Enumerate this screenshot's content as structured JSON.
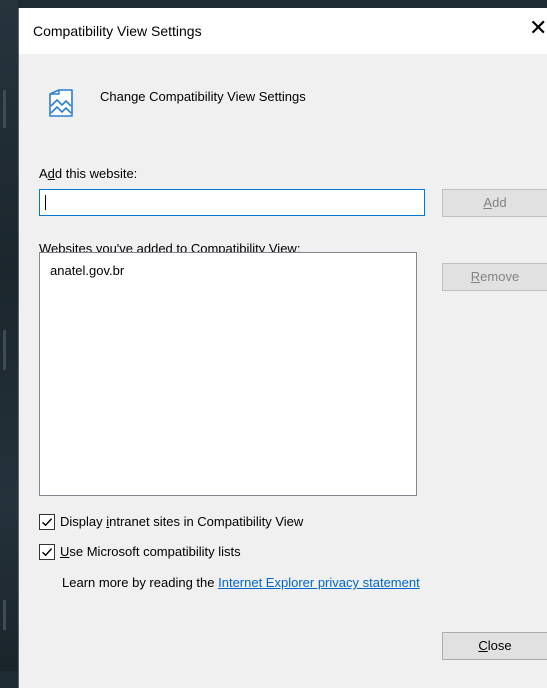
{
  "dialog": {
    "title": "Compatibility View Settings",
    "close_glyph": "✕",
    "header_icon": "compatibility-page-icon",
    "header_text": "Change Compatibility View Settings"
  },
  "add_section": {
    "label_prefix": "A",
    "label_mnemonic": "d",
    "label_suffix": "d this website:",
    "input_value": "",
    "add_button_mnemonic": "A",
    "add_button_rest": "dd"
  },
  "list_section": {
    "label_mnemonic": "W",
    "label_rest": "ebsites you've added to Compatibility View:",
    "items": [
      "anatel.gov.br"
    ],
    "remove_button_mnemonic": "R",
    "remove_button_rest": "emove"
  },
  "options": {
    "intranet": {
      "checked": true,
      "prefix": "Display ",
      "mnemonic": "i",
      "rest": "ntranet sites in Compatibility View"
    },
    "ms_lists": {
      "checked": true,
      "prefix": "",
      "mnemonic": "U",
      "rest": "se Microsoft compatibility lists"
    }
  },
  "learn_more": {
    "text": "Learn more by reading the ",
    "link_text": "Internet Explorer privacy statement"
  },
  "footer": {
    "close_mnemonic": "C",
    "close_rest": "lose"
  },
  "colors": {
    "accent": "#0078d7",
    "link": "#0066cc",
    "dialog_bg": "#f0f0f0"
  }
}
